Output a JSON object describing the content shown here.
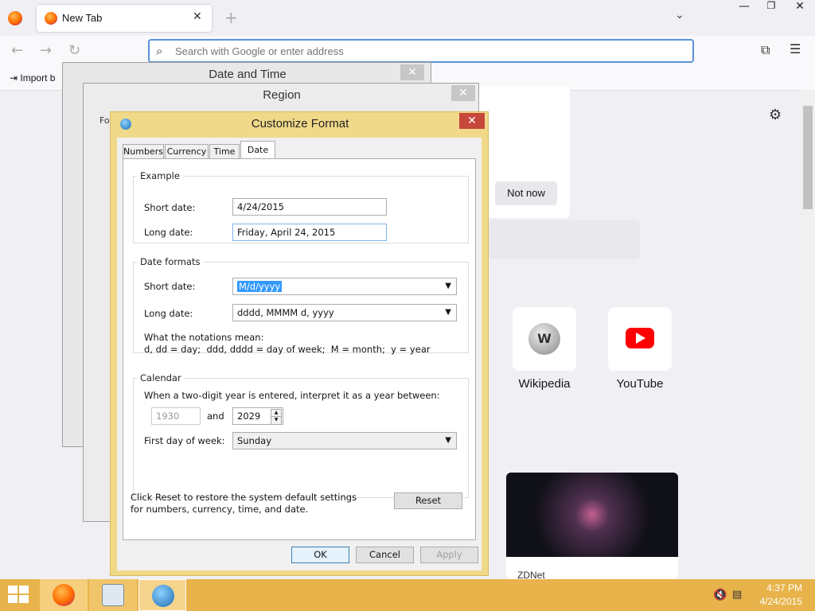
{
  "browser": {
    "tab_title": "New Tab",
    "tab_close": "✕",
    "new_tab": "+",
    "tab_list": "⌄",
    "address_placeholder": "Search with Google or enter address",
    "import_bookmarks": "Import b",
    "window_min": "—",
    "window_max": "❐",
    "window_close": "✕"
  },
  "newtab": {
    "not_now": "Not now",
    "shortcuts": [
      {
        "label": "Wikipedia"
      },
      {
        "label": "YouTube"
      }
    ],
    "news_title": "ZDNet"
  },
  "dialogs": {
    "date_time_title": "Date and Time",
    "region_title": "Region",
    "region_tab_partial": "Fo"
  },
  "customize_format": {
    "title": "Customize Format",
    "tabs": [
      "Numbers",
      "Currency",
      "Time",
      "Date"
    ],
    "active_tab": "Date",
    "example": {
      "legend": "Example",
      "short_label": "Short date:",
      "short_value": "4/24/2015",
      "long_label": "Long date:",
      "long_value": "Friday, April 24, 2015"
    },
    "date_formats": {
      "legend": "Date formats",
      "short_label": "Short date:",
      "short_value": "M/d/yyyy",
      "long_label": "Long date:",
      "long_value": "dddd, MMMM d, yyyy",
      "notation_title": "What the notations mean:",
      "notation_text": "d, dd = day;  ddd, dddd = day of week;  M = month;  y = year"
    },
    "calendar": {
      "legend": "Calendar",
      "two_digit_text": "When a two-digit year is entered, interpret it as a year between:",
      "year_from": "1930",
      "and_label": "and",
      "year_to": "2029",
      "first_day_label": "First day of week:",
      "first_day_value": "Sunday"
    },
    "reset_text": "Click Reset to restore the system default settings for numbers, currency, time, and date.",
    "reset_button": "Reset",
    "ok_button": "OK",
    "cancel_button": "Cancel",
    "apply_button": "Apply"
  },
  "taskbar": {
    "time": "4:37 PM",
    "date": "4/24/2015"
  },
  "colors": {
    "taskbar": "#e7b34a",
    "dialog_frame": "#f1d98a",
    "close_red": "#c7473b",
    "selection": "#3399ff"
  }
}
